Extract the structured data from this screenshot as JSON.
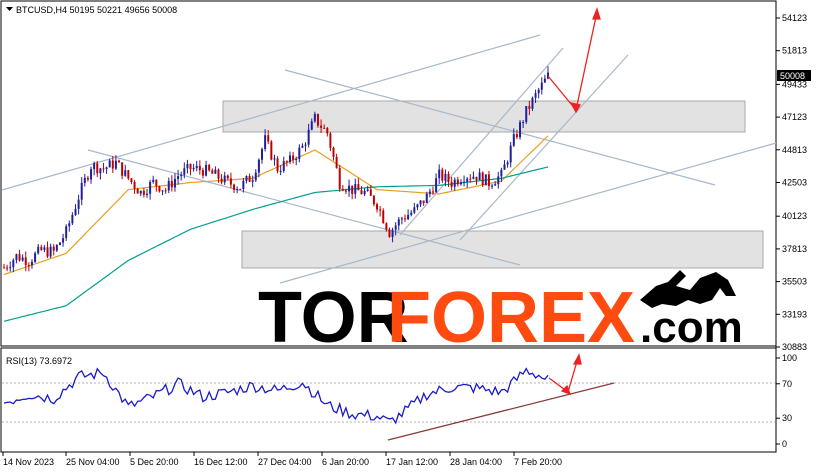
{
  "chart_data": [
    {
      "type": "candlestick",
      "symbol_line": "BTCUSD,H4  50195 50221 49656 50008",
      "last_price_label": "50008",
      "ylim": [
        30000,
        55000
      ],
      "y_ticks": [
        54123,
        51813,
        49433,
        47123,
        44813,
        42503,
        40123,
        37813,
        35503,
        33193,
        30883
      ],
      "x_tick_labels": [
        "14 Nov 2023",
        "25 Nov 04:00",
        "5 Dec 20:00",
        "16 Dec 12:00",
        "27 Dec 04:00",
        "6 Jan 20:00",
        "17 Jan 12:00",
        "28 Jan 04:00",
        "7 Feb 20:00"
      ],
      "price_path": [
        [
          0,
          36500
        ],
        [
          4,
          37300
        ],
        [
          8,
          37000
        ],
        [
          12,
          37700
        ],
        [
          16,
          37600
        ],
        [
          20,
          39000
        ],
        [
          24,
          41500
        ],
        [
          28,
          43700
        ],
        [
          32,
          43500
        ],
        [
          36,
          43900
        ],
        [
          40,
          42800
        ],
        [
          44,
          41800
        ],
        [
          48,
          42500
        ],
        [
          52,
          42000
        ],
        [
          56,
          43000
        ],
        [
          60,
          43500
        ],
        [
          64,
          43400
        ],
        [
          68,
          43000
        ],
        [
          72,
          42500
        ],
        [
          76,
          42200
        ],
        [
          80,
          43000
        ],
        [
          84,
          45500
        ],
        [
          88,
          43500
        ],
        [
          92,
          44000
        ],
        [
          96,
          45000
        ],
        [
          100,
          47000
        ],
        [
          104,
          46000
        ],
        [
          108,
          42500
        ],
        [
          112,
          42000
        ],
        [
          116,
          41800
        ],
        [
          120,
          41000
        ],
        [
          124,
          39000
        ],
        [
          128,
          40000
        ],
        [
          132,
          40500
        ],
        [
          136,
          41500
        ],
        [
          140,
          43000
        ],
        [
          144,
          42500
        ],
        [
          148,
          43000
        ],
        [
          152,
          43000
        ],
        [
          156,
          42500
        ],
        [
          160,
          43000
        ],
        [
          164,
          45500
        ],
        [
          168,
          47500
        ],
        [
          172,
          49000
        ],
        [
          175,
          50008
        ]
      ],
      "moving_averages": [
        {
          "color": "#e8a020",
          "values": [
            [
              0,
              36000
            ],
            [
              20,
              37500
            ],
            [
              40,
              42000
            ],
            [
              60,
              42500
            ],
            [
              80,
              42800
            ],
            [
              100,
              44800
            ],
            [
              120,
              42000
            ],
            [
              140,
              41700
            ],
            [
              160,
              42600
            ],
            [
              175,
              45800
            ]
          ]
        },
        {
          "color": "#00a090",
          "values": [
            [
              0,
              32700
            ],
            [
              20,
              33800
            ],
            [
              40,
              37000
            ],
            [
              60,
              39200
            ],
            [
              80,
              40600
            ],
            [
              100,
              41800
            ],
            [
              120,
              42200
            ],
            [
              140,
              42300
            ],
            [
              160,
              42800
            ],
            [
              175,
              43600
            ]
          ]
        }
      ],
      "resistance_zone": [
        46150,
        48650
      ],
      "support_zone": [
        36350,
        39350
      ]
    },
    {
      "type": "line",
      "label": "RSI(13) 73.6972",
      "ylim": [
        0,
        100
      ],
      "y_ticks": [
        100,
        70,
        30,
        0
      ],
      "x": [
        0,
        8,
        16,
        24,
        32,
        40,
        48,
        56,
        64,
        72,
        80,
        88,
        96,
        104,
        112,
        120,
        124,
        128,
        136,
        144,
        152,
        160,
        164,
        168,
        172,
        175
      ],
      "values": [
        48,
        58,
        53,
        78,
        83,
        43,
        55,
        70,
        55,
        60,
        68,
        62,
        72,
        45,
        35,
        32,
        25,
        35,
        58,
        66,
        65,
        60,
        72,
        86,
        80,
        73.7
      ]
    }
  ],
  "brand": {
    "part1": "TOR",
    "part2": "FOREX",
    "part3": ".com"
  },
  "colors": {
    "bull": "#1f1f9a",
    "bear": "#c00000",
    "rsi": "#1a1acc",
    "channel": "#a8b8c8",
    "arrow": "#ee2222",
    "zone_fill": "#e2e2e2"
  }
}
